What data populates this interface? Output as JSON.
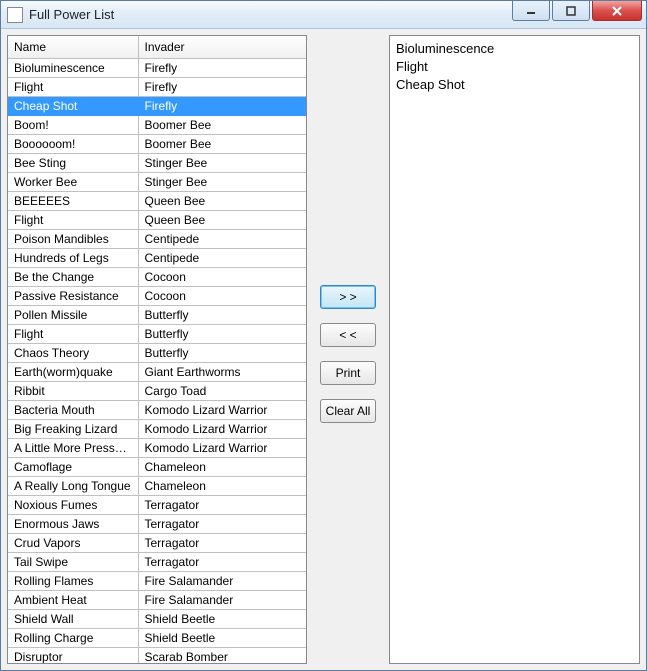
{
  "window": {
    "title": "Full Power List"
  },
  "table": {
    "headers": {
      "name": "Name",
      "invader": "Invader"
    },
    "selected_index": 2,
    "rows": [
      {
        "name": "Bioluminescence",
        "invader": "Firefly"
      },
      {
        "name": "Flight",
        "invader": "Firefly"
      },
      {
        "name": "Cheap Shot",
        "invader": "Firefly"
      },
      {
        "name": "Boom!",
        "invader": "Boomer Bee"
      },
      {
        "name": "Boooooom!",
        "invader": "Boomer Bee"
      },
      {
        "name": "Bee Sting",
        "invader": "Stinger Bee"
      },
      {
        "name": "Worker Bee",
        "invader": "Stinger Bee"
      },
      {
        "name": "BEEEEES",
        "invader": "Queen Bee"
      },
      {
        "name": "Flight",
        "invader": "Queen Bee"
      },
      {
        "name": "Poison Mandibles",
        "invader": "Centipede"
      },
      {
        "name": "Hundreds of Legs",
        "invader": "Centipede"
      },
      {
        "name": "Be the Change",
        "invader": "Cocoon"
      },
      {
        "name": "Passive Resistance",
        "invader": "Cocoon"
      },
      {
        "name": "Pollen Missile",
        "invader": "Butterfly"
      },
      {
        "name": "Flight",
        "invader": "Butterfly"
      },
      {
        "name": "Chaos Theory",
        "invader": "Butterfly"
      },
      {
        "name": "Earth(worm)quake",
        "invader": "Giant Earthworms"
      },
      {
        "name": "Ribbit",
        "invader": "Cargo Toad"
      },
      {
        "name": "Bacteria Mouth",
        "invader": "Komodo Lizard Warrior"
      },
      {
        "name": "Big Freaking Lizard",
        "invader": "Komodo Lizard Warrior"
      },
      {
        "name": "A Little More Pressure",
        "invader": "Komodo Lizard Warrior"
      },
      {
        "name": "Camoflage",
        "invader": "Chameleon"
      },
      {
        "name": "A Really Long Tongue",
        "invader": "Chameleon"
      },
      {
        "name": "Noxious Fumes",
        "invader": "Terragator"
      },
      {
        "name": "Enormous Jaws",
        "invader": "Terragator"
      },
      {
        "name": "Crud Vapors",
        "invader": "Terragator"
      },
      {
        "name": "Tail Swipe",
        "invader": "Terragator"
      },
      {
        "name": "Rolling Flames",
        "invader": "Fire Salamander"
      },
      {
        "name": "Ambient Heat",
        "invader": "Fire Salamander"
      },
      {
        "name": "Shield Wall",
        "invader": "Shield Beetle"
      },
      {
        "name": "Rolling Charge",
        "invader": "Shield Beetle"
      },
      {
        "name": "Disruptor",
        "invader": "Scarab Bomber"
      }
    ]
  },
  "buttons": {
    "add": "> >",
    "remove": "< <",
    "print": "Print",
    "clear": "Clear All"
  },
  "selected_list": [
    "Bioluminescence",
    "Flight",
    "Cheap Shot"
  ]
}
